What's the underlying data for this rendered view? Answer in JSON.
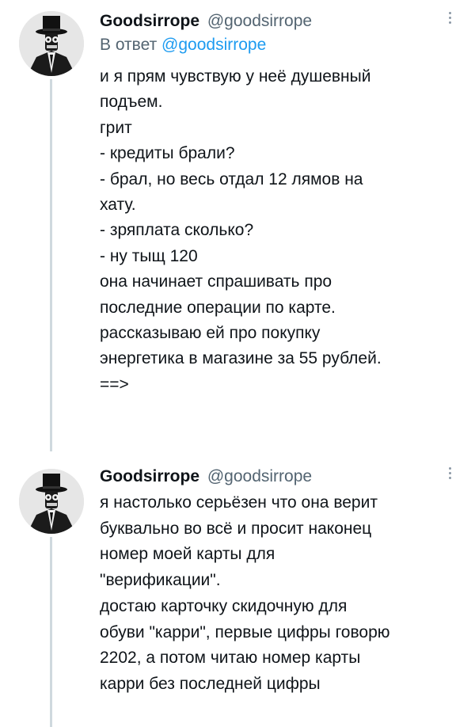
{
  "tweets": [
    {
      "display_name": "Goodsirrope",
      "handle": "@goodsirrope",
      "reply_prefix": "В ответ",
      "reply_mention": "@goodsirrope",
      "lines": [
        "и я прям чувствую у неё душевный",
        "подъем.",
        "грит",
        "- кредиты брали?",
        "- брал, но весь отдал 12 лямов на",
        "хату.",
        "- зряплата сколько?",
        "- ну тыщ 120",
        "она начинает спрашивать про",
        "последние операции по карте.",
        "рассказываю ей про покупку",
        "энергетика в магазине за 55 рублей.",
        "==>"
      ]
    },
    {
      "display_name": "Goodsirrope",
      "handle": "@goodsirrope",
      "lines": [
        "я настолько серьёзен что она верит",
        "буквально во всё и просит наконец",
        "номер моей карты для",
        "\"верификации\".",
        "достаю карточку скидочную для",
        "обуви \"карри\", первые цифры говорю",
        "2202, а потом читаю номер карты",
        "карри без последней цифры"
      ]
    }
  ],
  "icons": {
    "avatar": "top-hat-character-avatar",
    "more": "more-vertical-icon"
  },
  "colors": {
    "handle": "#536471",
    "mention": "#1d9bf0",
    "text": "#0f1419",
    "thread_line": "#cfd9de"
  }
}
